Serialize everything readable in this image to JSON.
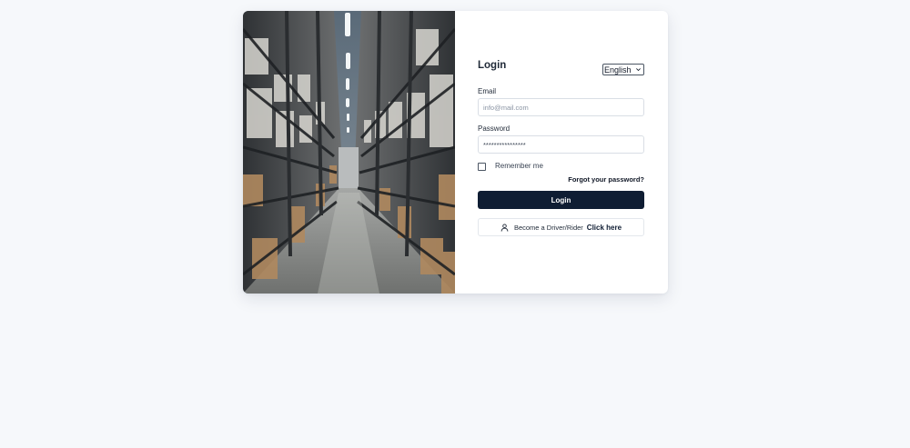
{
  "login": {
    "title": "Login",
    "language": "English",
    "email_label": "Email",
    "email_placeholder": "info@mail.com",
    "password_label": "Password",
    "password_value": "****************",
    "remember_label": "Remember me",
    "forgot_label": "Forgot your password?",
    "login_button": "Login",
    "driver_text": "Become a Driver/Rider",
    "driver_link": "Click here"
  },
  "icons": {
    "language_chevron": "chevron-down-icon",
    "driver": "user-icon"
  },
  "colors": {
    "page_bg": "#f6f8fb",
    "primary": "#0f1d33"
  }
}
